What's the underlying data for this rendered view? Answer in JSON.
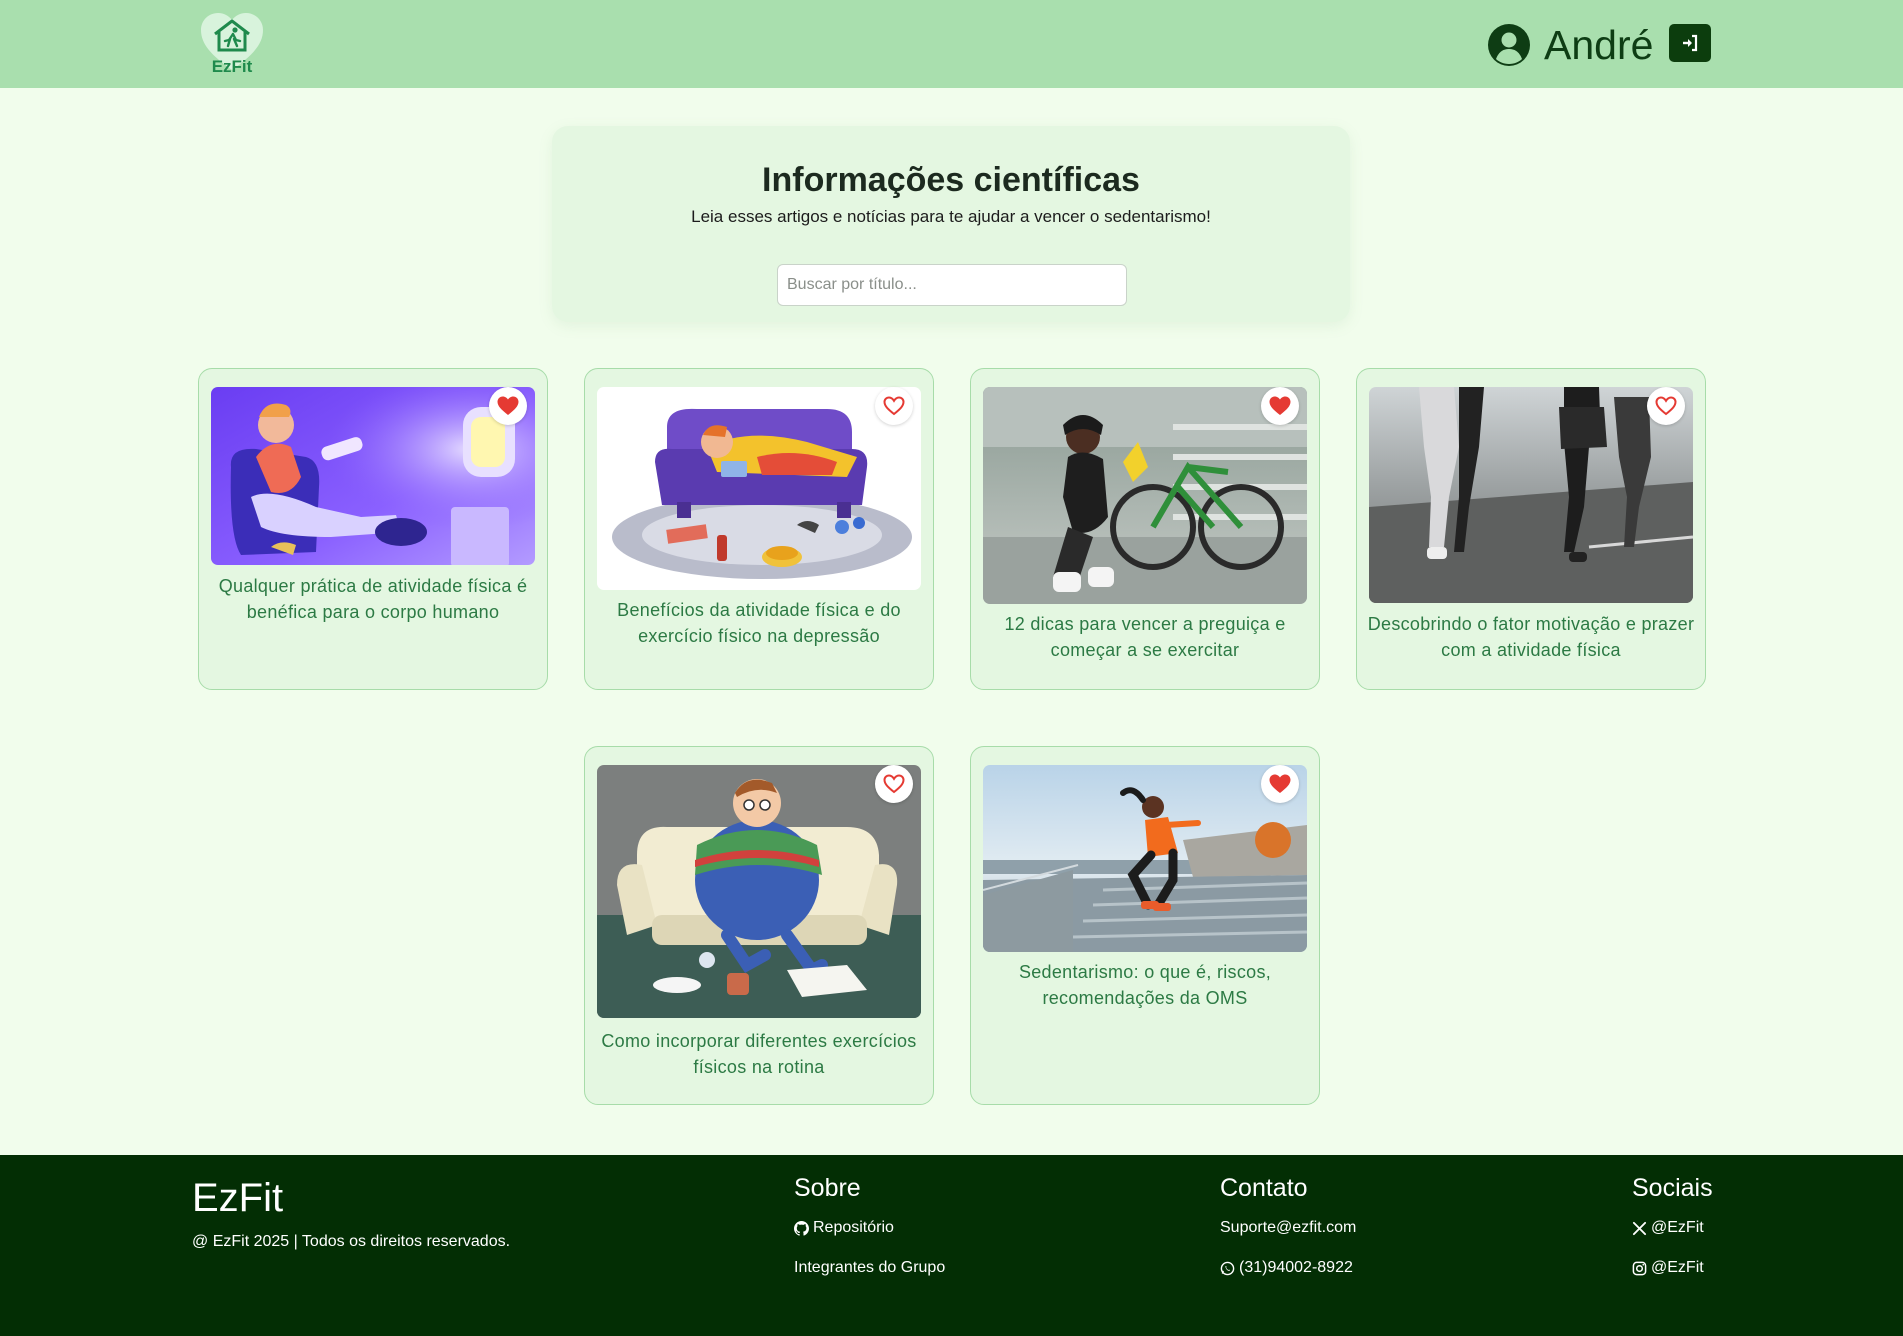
{
  "header": {
    "logo_text": "EzFit",
    "user_name": "André",
    "user_icon": "user-circle-icon",
    "login_icon": "sign-in-icon"
  },
  "intro": {
    "title": "Informações científicas",
    "subtitle": "Leia esses artigos e notícias para te ajudar a vencer o sedentarismo!",
    "search_placeholder": "Buscar por título..."
  },
  "articles": [
    {
      "title": "Qualquer prática de atividade física é benéfica para o corpo humano",
      "favorited": true,
      "image": "cartoon-man-on-couch-with-tv"
    },
    {
      "title": "Benefícios da atividade física e do exercício físico na depressão",
      "favorited": false,
      "image": "cartoon-boy-on-purple-sofa"
    },
    {
      "title": "12 dicas para vencer a preguiça e começar a se exercitar",
      "favorited": true,
      "image": "woman-with-bicycle"
    },
    {
      "title": "Descobrindo o fator motivação e prazer com a atividade física",
      "favorited": false,
      "image": "people-running-on-road"
    },
    {
      "title": "Como incorporar diferentes exercícios físicos na rotina",
      "favorited": false,
      "image": "cartoon-man-on-sofa-with-snacks"
    },
    {
      "title": "Sedentarismo: o que é, riscos, recomendações da OMS",
      "favorited": true,
      "image": "woman-jumping-on-stairs"
    }
  ],
  "footer": {
    "brand": "EzFit",
    "copyright": "@ EzFit 2025 | Todos os direitos reservados.",
    "sobre": {
      "heading": "Sobre",
      "links": [
        "Repositório",
        "Integrantes do Grupo"
      ]
    },
    "contato": {
      "heading": "Contato",
      "email": "Suporte@ezfit.com",
      "phone": "(31)94002-8922"
    },
    "sociais": {
      "heading": "Sociais",
      "x": "@EzFit",
      "instagram": "@EzFit"
    }
  },
  "colors": {
    "header_bg": "#a9dfae",
    "page_bg": "#f1fdec",
    "card_bg": "#e4f7e1",
    "card_border": "#a7dca9",
    "title_green": "#2c7a44",
    "footer_bg": "#032e04",
    "heart_red": "#e53a33"
  }
}
